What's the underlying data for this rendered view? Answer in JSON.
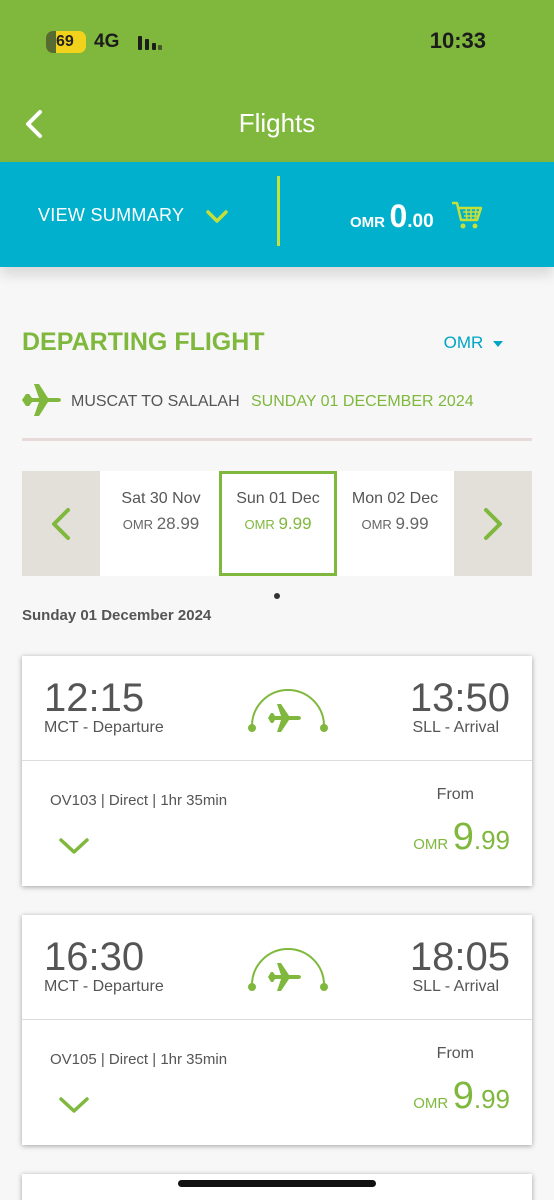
{
  "status_bar": {
    "battery": "69",
    "network": "4G",
    "time": "10:33"
  },
  "header": {
    "title": "Flights"
  },
  "summary": {
    "view_label": "VIEW SUMMARY",
    "currency": "OMR",
    "amount_whole": "0",
    "amount_decimal": ".00"
  },
  "departing": {
    "title": "DEPARTING FLIGHT",
    "currency_selector": "OMR",
    "route": "MUSCAT TO SALALAH",
    "route_date": "SUNDAY 01 DECEMBER 2024"
  },
  "dates": [
    {
      "label": "Sat 30 Nov",
      "currency": "OMR",
      "price": "28.99",
      "selected": false
    },
    {
      "label": "Sun 01 Dec",
      "currency": "OMR",
      "price": "9.99",
      "selected": true
    },
    {
      "label": "Mon 02 Dec",
      "currency": "OMR",
      "price": "9.99",
      "selected": false
    }
  ],
  "day_label": "Sunday 01 December 2024",
  "flights": [
    {
      "dep_time": "12:15",
      "dep_label": "MCT - Departure",
      "arr_time": "13:50",
      "arr_label": "SLL - Arrival",
      "info": "OV103 | Direct | 1hr 35min",
      "from_label": "From",
      "currency": "OMR",
      "price_whole": "9",
      "price_decimal": ".99"
    },
    {
      "dep_time": "16:30",
      "dep_label": "MCT - Departure",
      "arr_time": "18:05",
      "arr_label": "SLL - Arrival",
      "info": "OV105 | Direct | 1hr 35min",
      "from_label": "From",
      "currency": "OMR",
      "price_whole": "9",
      "price_decimal": ".99"
    }
  ],
  "colors": {
    "brand_green": "#7fb83d",
    "brand_blue": "#00b0cc",
    "accent_lime": "#c6e03a"
  }
}
